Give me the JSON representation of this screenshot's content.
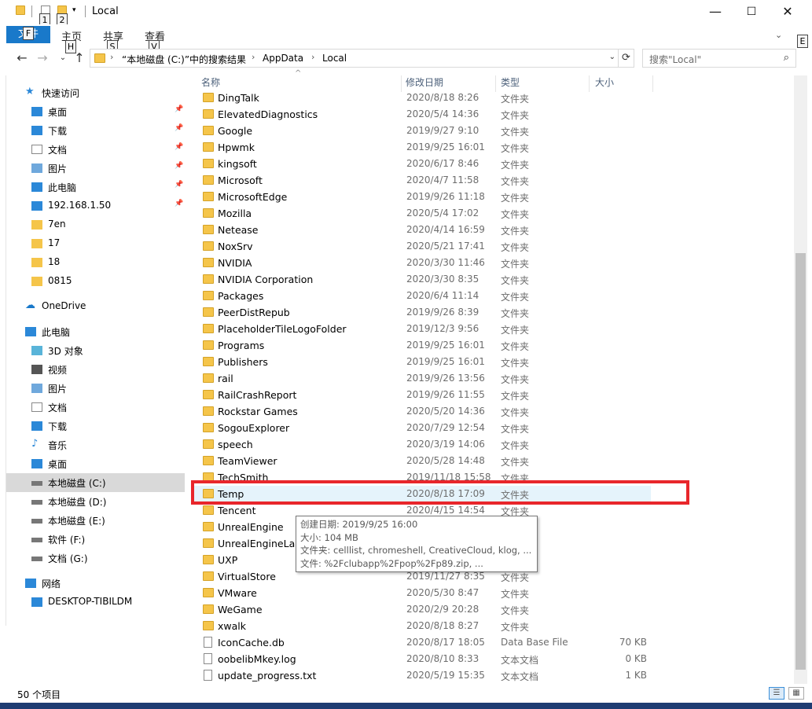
{
  "window": {
    "title": "Local"
  },
  "keytips": {
    "qa1": "1",
    "qa2": "2",
    "file": "F",
    "home": "H",
    "share": "S",
    "view": "V",
    "help": "E"
  },
  "ribbon": {
    "file": "文件",
    "home": "主页",
    "share": "共享",
    "view": "查看"
  },
  "address": {
    "crumbs": [
      "“本地磁盘 (C:)”中的搜索结果",
      "AppData",
      "Local"
    ]
  },
  "search": {
    "placeholder": "搜索\"Local\""
  },
  "nav": {
    "items": [
      {
        "label": "快速访问",
        "icon": "star-icon"
      },
      {
        "label": "桌面",
        "icon": "desktop-icon",
        "pinned": true
      },
      {
        "label": "下载",
        "icon": "download-icon",
        "pinned": true
      },
      {
        "label": "文档",
        "icon": "document-icon",
        "pinned": true
      },
      {
        "label": "图片",
        "icon": "picture-icon",
        "pinned": true
      },
      {
        "label": "此电脑",
        "icon": "computer-icon",
        "pinned": true
      },
      {
        "label": "192.168.1.50",
        "icon": "network-drive-icon",
        "pinned": true
      },
      {
        "label": "7en",
        "icon": "folder-icon"
      },
      {
        "label": "17",
        "icon": "folder-icon"
      },
      {
        "label": "18",
        "icon": "folder-icon"
      },
      {
        "label": "0815",
        "icon": "folder-icon"
      },
      {
        "label": "OneDrive",
        "icon": "cloud-icon"
      },
      {
        "label": "此电脑",
        "icon": "computer-icon"
      },
      {
        "label": "3D 对象",
        "icon": "cube-icon"
      },
      {
        "label": "视频",
        "icon": "video-icon"
      },
      {
        "label": "图片",
        "icon": "picture-icon"
      },
      {
        "label": "文档",
        "icon": "document-icon"
      },
      {
        "label": "下载",
        "icon": "download-icon"
      },
      {
        "label": "音乐",
        "icon": "music-icon"
      },
      {
        "label": "桌面",
        "icon": "desktop-icon"
      },
      {
        "label": "本地磁盘 (C:)",
        "icon": "drive-icon"
      },
      {
        "label": "本地磁盘 (D:)",
        "icon": "drive-icon"
      },
      {
        "label": "本地磁盘 (E:)",
        "icon": "drive-icon"
      },
      {
        "label": "软件 (F:)",
        "icon": "drive-icon"
      },
      {
        "label": "文档 (G:)",
        "icon": "drive-icon"
      },
      {
        "label": "网络",
        "icon": "network-icon"
      },
      {
        "label": "DESKTOP-TIBILDM",
        "icon": "computer-icon"
      }
    ]
  },
  "columns": {
    "name": "名称",
    "date": "修改日期",
    "type": "类型",
    "size": "大小"
  },
  "files": [
    {
      "name": "DingTalk",
      "date": "2020/8/18 8:26",
      "type": "文件夹",
      "size": "",
      "kind": "folder"
    },
    {
      "name": "ElevatedDiagnostics",
      "date": "2020/5/4 14:36",
      "type": "文件夹",
      "size": "",
      "kind": "folder"
    },
    {
      "name": "Google",
      "date": "2019/9/27 9:10",
      "type": "文件夹",
      "size": "",
      "kind": "folder"
    },
    {
      "name": "Hpwmk",
      "date": "2019/9/25 16:01",
      "type": "文件夹",
      "size": "",
      "kind": "folder"
    },
    {
      "name": "kingsoft",
      "date": "2020/6/17 8:46",
      "type": "文件夹",
      "size": "",
      "kind": "folder"
    },
    {
      "name": "Microsoft",
      "date": "2020/4/7 11:58",
      "type": "文件夹",
      "size": "",
      "kind": "folder"
    },
    {
      "name": "MicrosoftEdge",
      "date": "2019/9/26 11:18",
      "type": "文件夹",
      "size": "",
      "kind": "folder"
    },
    {
      "name": "Mozilla",
      "date": "2020/5/4 17:02",
      "type": "文件夹",
      "size": "",
      "kind": "folder"
    },
    {
      "name": "Netease",
      "date": "2020/4/14 16:59",
      "type": "文件夹",
      "size": "",
      "kind": "folder"
    },
    {
      "name": "NoxSrv",
      "date": "2020/5/21 17:41",
      "type": "文件夹",
      "size": "",
      "kind": "folder"
    },
    {
      "name": "NVIDIA",
      "date": "2020/3/30 11:46",
      "type": "文件夹",
      "size": "",
      "kind": "folder"
    },
    {
      "name": "NVIDIA Corporation",
      "date": "2020/3/30 8:35",
      "type": "文件夹",
      "size": "",
      "kind": "folder"
    },
    {
      "name": "Packages",
      "date": "2020/6/4 11:14",
      "type": "文件夹",
      "size": "",
      "kind": "folder"
    },
    {
      "name": "PeerDistRepub",
      "date": "2019/9/26 8:39",
      "type": "文件夹",
      "size": "",
      "kind": "folder"
    },
    {
      "name": "PlaceholderTileLogoFolder",
      "date": "2019/12/3 9:56",
      "type": "文件夹",
      "size": "",
      "kind": "folder"
    },
    {
      "name": "Programs",
      "date": "2019/9/25 16:01",
      "type": "文件夹",
      "size": "",
      "kind": "folder"
    },
    {
      "name": "Publishers",
      "date": "2019/9/25 16:01",
      "type": "文件夹",
      "size": "",
      "kind": "folder"
    },
    {
      "name": "rail",
      "date": "2019/9/26 13:56",
      "type": "文件夹",
      "size": "",
      "kind": "folder"
    },
    {
      "name": "RailCrashReport",
      "date": "2019/9/26 11:55",
      "type": "文件夹",
      "size": "",
      "kind": "folder"
    },
    {
      "name": "Rockstar Games",
      "date": "2020/5/20 14:36",
      "type": "文件夹",
      "size": "",
      "kind": "folder"
    },
    {
      "name": "SogouExplorer",
      "date": "2020/7/29 12:54",
      "type": "文件夹",
      "size": "",
      "kind": "folder"
    },
    {
      "name": "speech",
      "date": "2020/3/19 14:06",
      "type": "文件夹",
      "size": "",
      "kind": "folder"
    },
    {
      "name": "TeamViewer",
      "date": "2020/5/28 14:48",
      "type": "文件夹",
      "size": "",
      "kind": "folder"
    },
    {
      "name": "TechSmith",
      "date": "2019/11/18 15:58",
      "type": "文件夹",
      "size": "",
      "kind": "folder"
    },
    {
      "name": "Temp",
      "date": "2020/8/18 17:09",
      "type": "文件夹",
      "size": "",
      "kind": "folder",
      "highlighted": true
    },
    {
      "name": "Tencent",
      "date": "2020/4/15 14:54",
      "type": "文件夹",
      "size": "",
      "kind": "folder"
    },
    {
      "name": "UnrealEngine",
      "date": "",
      "type": "",
      "size": "",
      "kind": "folder"
    },
    {
      "name": "UnrealEngineLau",
      "date": "",
      "type": "",
      "size": "",
      "kind": "folder"
    },
    {
      "name": "UXP",
      "date": "",
      "type": "",
      "size": "",
      "kind": "folder"
    },
    {
      "name": "VirtualStore",
      "date": "2019/11/27 8:35",
      "type": "文件夹",
      "size": "",
      "kind": "folder"
    },
    {
      "name": "VMware",
      "date": "2020/5/30 8:47",
      "type": "文件夹",
      "size": "",
      "kind": "folder"
    },
    {
      "name": "WeGame",
      "date": "2020/2/9 20:28",
      "type": "文件夹",
      "size": "",
      "kind": "folder"
    },
    {
      "name": "xwalk",
      "date": "2020/8/18 8:27",
      "type": "文件夹",
      "size": "",
      "kind": "folder"
    },
    {
      "name": "IconCache.db",
      "date": "2020/8/17 18:05",
      "type": "Data Base File",
      "size": "70 KB",
      "kind": "file"
    },
    {
      "name": "oobelibMkey.log",
      "date": "2020/8/10 8:33",
      "type": "文本文档",
      "size": "0 KB",
      "kind": "file"
    },
    {
      "name": "update_progress.txt",
      "date": "2020/5/19 15:35",
      "type": "文本文档",
      "size": "1 KB",
      "kind": "file"
    }
  ],
  "tooltip": {
    "lines": [
      "创建日期: 2019/9/25 16:00",
      "大小: 104 MB",
      "文件夹: celllist, chromeshell, CreativeCloud, klog, ...",
      "文件: %2Fclubapp%2Fpop%2Fp89.zip, ..."
    ]
  },
  "status": {
    "count": "50 个项目"
  },
  "colors": {
    "accent": "#1979ca",
    "folder": "#f5c54a",
    "highlight": "#e5f3fb",
    "annotation": "#e8262b"
  }
}
